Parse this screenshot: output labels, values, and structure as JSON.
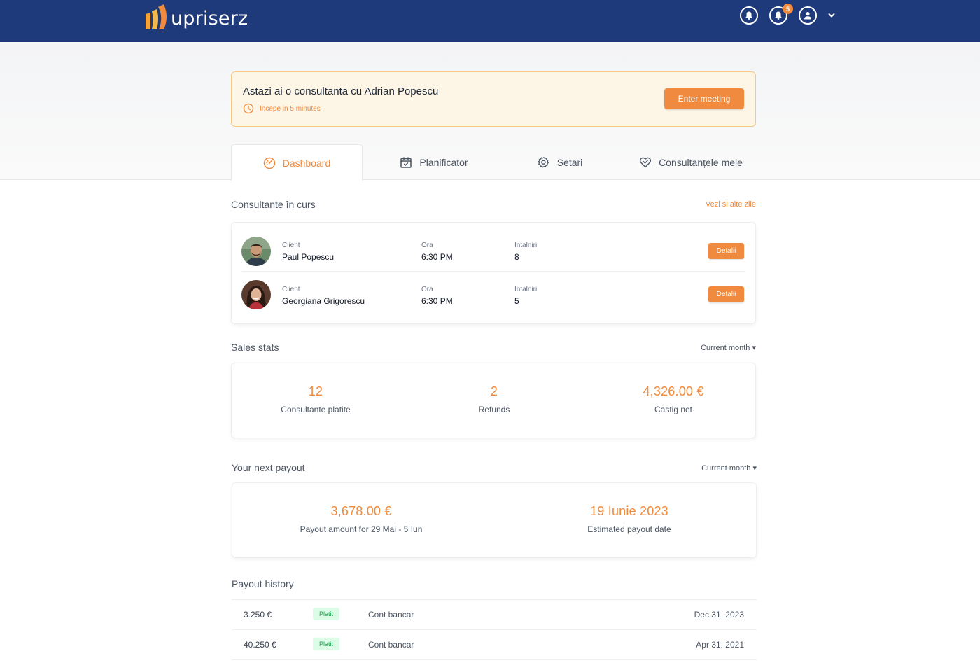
{
  "header": {
    "brand": "upriserz",
    "notification_count": "5"
  },
  "alert": {
    "title": "Astazi ai o consultanta cu Adrian Popescu",
    "subtitle": "Incepe in 5 minutes",
    "button": "Enter meeting"
  },
  "tabs": [
    {
      "label": "Dashboard",
      "icon": "gauge-icon",
      "active": true
    },
    {
      "label": "Planificator",
      "icon": "calendar-icon",
      "active": false
    },
    {
      "label": "Setari",
      "icon": "gear-icon",
      "active": false
    },
    {
      "label": "Consultanțele mele",
      "icon": "heart-handshake-icon",
      "active": false
    }
  ],
  "consultations": {
    "title": "Consultante în curs",
    "link": "Vezi si alte zile",
    "rows": [
      {
        "client_label": "Client",
        "client": "Paul Popescu",
        "time_label": "Ora",
        "time": "6:30 PM",
        "meet_label": "Intalniri",
        "meetings": "8",
        "button": "Detalii"
      },
      {
        "client_label": "Client",
        "client": "Georgiana Grigorescu",
        "time_label": "Ora",
        "time": "6:30 PM",
        "meet_label": "Intalniri",
        "meetings": "5",
        "button": "Detalii"
      }
    ]
  },
  "sales": {
    "title": "Sales stats",
    "period": "Current month",
    "stats": [
      {
        "value": "12",
        "label": "Consultante platite"
      },
      {
        "value": "2",
        "label": "Refunds"
      },
      {
        "value": "4,326.00 €",
        "label": "Castig net"
      }
    ]
  },
  "payout": {
    "title": "Your next payout",
    "period": "Current month",
    "amount": "3,678.00 €",
    "amount_label": "Payout amount for 29 Mai - 5 Iun",
    "date": "19 Iunie 2023",
    "date_label": "Estimated payout date"
  },
  "history": {
    "title": "Payout history",
    "rows": [
      {
        "amount": "3.250 €",
        "status": "Platit",
        "method": "Cont bancar",
        "date": "Dec 31, 2023"
      },
      {
        "amount": "40.250 €",
        "status": "Platit",
        "method": "Cont bancar",
        "date": "Apr 31, 2021"
      }
    ]
  },
  "colors": {
    "header_bg": "#1e3a7b",
    "accent": "#f08a3e",
    "alert_bg": "#fdf5e6",
    "paid_badge_bg": "#dcfce7",
    "paid_badge_text": "#16a34a"
  }
}
